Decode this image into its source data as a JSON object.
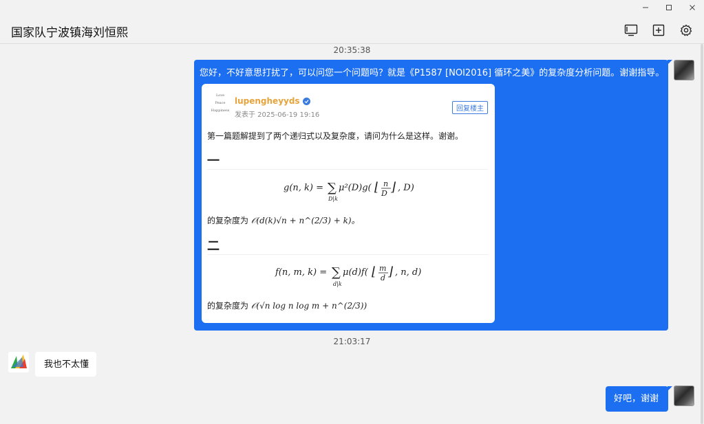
{
  "window": {
    "controls": [
      "minimize-icon",
      "maximize-icon",
      "close-icon"
    ]
  },
  "header": {
    "title": "国家队宁波镇海刘恒熙",
    "actions": [
      "screen-share-icon",
      "add-square-icon",
      "gear-icon"
    ]
  },
  "messages": [
    {
      "timestamp": "20:35:38",
      "sender": "self",
      "text": "您好，不好意思打扰了，可以问您一个问题吗？就是《P1587 [NOI2016] 循环之美》的复杂度分析问题。谢谢指导。",
      "card": {
        "avatar_lines": [
          "Love",
          "Peace",
          "Happiness"
        ],
        "username": "lupengheyyds",
        "date": "发表于  2025-06-19 19:16",
        "reply_label": "回复楼主",
        "description": "第一篇题解提到了两个递归式以及复杂度，请问为什么是这样。谢谢。",
        "section1": "一",
        "formula1": "g(n, k) = Σ_{D|k} μ²(D) g(⌊n/D⌋, D)",
        "complexity1_prefix": "的复杂度为",
        "complexity1": "𝒪(d(k)√n + n^(2/3) + k)。",
        "section2": "二",
        "formula2": "f(n, m, k) = Σ_{d|k} μ(d) f(⌊m/d⌋, n, d)",
        "complexity2_prefix": "的复杂度为",
        "complexity2": "𝒪(√n log n log m + n^(2/3))"
      }
    },
    {
      "timestamp": "21:03:17",
      "sender": "other",
      "text": "我也不太懂"
    },
    {
      "sender": "self",
      "text": "好吧，谢谢"
    }
  ],
  "colors": {
    "self_bubble": "#1d6ff2",
    "other_bubble": "#ffffff",
    "background": "#f2f2f2",
    "card_username": "#e8a33a",
    "accent": "#3a7be0"
  }
}
